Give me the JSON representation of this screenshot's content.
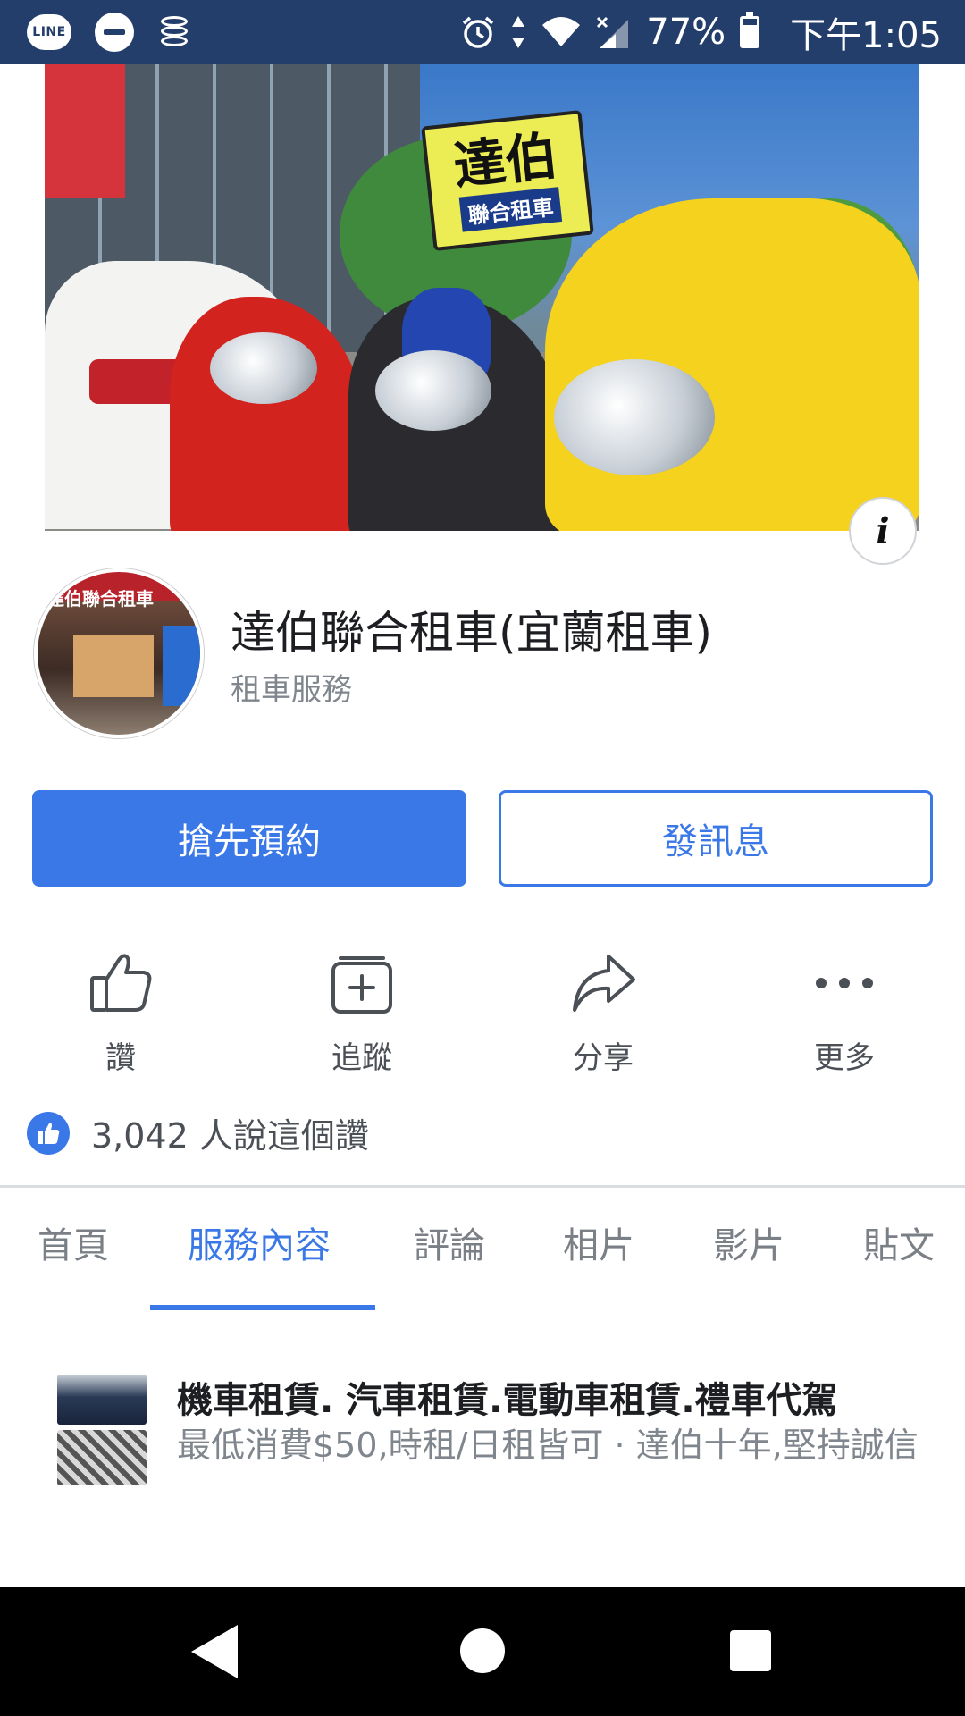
{
  "status_bar": {
    "line_icon_text": "LINE",
    "battery_percent": "77%",
    "time": "下午1:05",
    "icons": [
      "line-icon",
      "dnd-icon",
      "database-icon",
      "alarm-icon",
      "data-arrows-icon",
      "wifi-icon",
      "signal-icon",
      "battery-icon"
    ],
    "battery_level": 0.77,
    "color": "#243e6b"
  },
  "cover": {
    "sign_main": "達伯",
    "sign_sub": "聯合租車",
    "info_icon": "i"
  },
  "profile": {
    "avatar_sign": "達伯聯合租車",
    "name": "達伯聯合租車(宜蘭租車)",
    "category": "租車服務"
  },
  "buttons": {
    "primary_label": "搶先預約",
    "secondary_label": "發訊息",
    "accent": "#3b78e7"
  },
  "actions": [
    {
      "label": "讚",
      "icon": "thumbs-up-icon"
    },
    {
      "label": "追蹤",
      "icon": "follow-icon"
    },
    {
      "label": "分享",
      "icon": "share-icon"
    },
    {
      "label": "更多",
      "icon": "more-icon"
    }
  ],
  "likes": {
    "text": "3,042 人說這個讚"
  },
  "tabs": [
    {
      "label": "首頁",
      "active": false
    },
    {
      "label": "服務內容",
      "active": true
    },
    {
      "label": "評論",
      "active": false
    },
    {
      "label": "相片",
      "active": false
    },
    {
      "label": "影片",
      "active": false
    },
    {
      "label": "貼文",
      "active": false
    }
  ],
  "service": {
    "title": "機車租賃. 汽車租賃.電動車租賃.禮車代駕",
    "description": "最低消費$50,時租/日租皆可 · 達伯十年,堅持誠信"
  },
  "nav_bar": {
    "icons": [
      "back-icon",
      "home-icon",
      "recents-icon"
    ]
  }
}
